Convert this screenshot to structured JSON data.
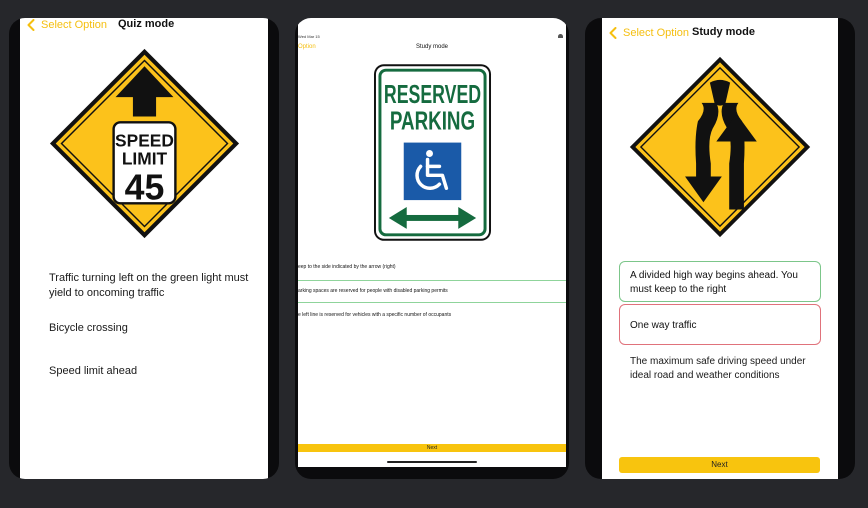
{
  "colors": {
    "accent": "#f5bf10",
    "sign_yellow": "#fcc21b",
    "sign_green": "#156b3f",
    "correct_border": "#7cc68a",
    "wrong_border": "#e0727b",
    "background": "#26272b"
  },
  "left": {
    "back_label": "Select Option",
    "title": "Quiz mode",
    "sign": {
      "type": "speed-limit-ahead",
      "line1": "SPEED",
      "line2": "LIMIT",
      "value": "45"
    },
    "answers": [
      "Traffic turning left on the green light must yield to oncoming traffic",
      "Bicycle crossing",
      "Speed limit ahead"
    ]
  },
  "middle": {
    "status_time": "Wed Mar 15",
    "back_label": "Option",
    "title": "Study mode",
    "sign": {
      "line1": "RESERVED",
      "line2": "PARKING"
    },
    "answers": [
      "eep to the side indicated by the arrow (right)",
      "arking spaces are reserved for people with disabled parking permits",
      "e left line is reserved for vehicles with a specific number of occupants"
    ],
    "next_label": "Next"
  },
  "right": {
    "back_label": "Select Option",
    "title": "Study mode",
    "sign": {
      "type": "divided-highway"
    },
    "answers": [
      {
        "text": "A divided high way begins ahead. You must keep to the right",
        "state": "correct"
      },
      {
        "text": "One way traffic",
        "state": "wrong"
      },
      {
        "text": "The maximum safe driving speed under ideal road and weather conditions",
        "state": "none"
      }
    ],
    "next_label": "Next"
  }
}
